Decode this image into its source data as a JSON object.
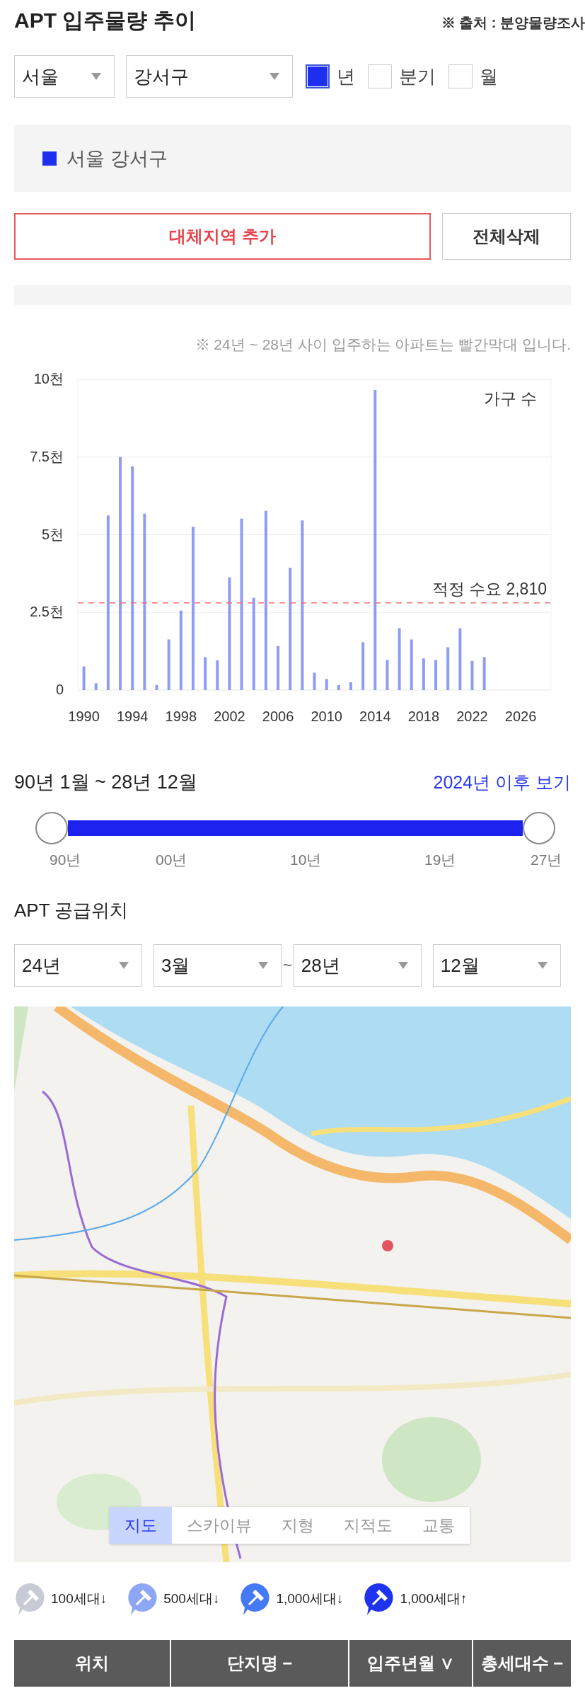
{
  "header": {
    "title": "APT 입주물량 추이",
    "source": "※ 출처 : 분양물량조사"
  },
  "filters": {
    "selects": [
      {
        "value": "서울"
      },
      {
        "value": "강서구"
      }
    ],
    "periods": [
      {
        "label": "년",
        "selected": true
      },
      {
        "label": "분기",
        "selected": false
      },
      {
        "label": "월",
        "selected": false
      }
    ]
  },
  "regions": [
    {
      "label": "서울 강서구",
      "color": "#1e2ff0"
    }
  ],
  "buttons": {
    "add": "대체지역 추가",
    "clear": "전체삭제"
  },
  "note": "※ 24년 ~ 28년 사이 입주하는 아파트는 빨간막대 입니다.",
  "chart": {
    "chart_data": {
      "type": "bar",
      "x": [
        1990,
        1991,
        1992,
        1993,
        1994,
        1995,
        1996,
        1997,
        1998,
        1999,
        2000,
        2001,
        2002,
        2003,
        2004,
        2005,
        2006,
        2007,
        2008,
        2009,
        2010,
        2011,
        2012,
        2013,
        2014,
        2015,
        2016,
        2017,
        2018,
        2019,
        2020,
        2021,
        2022,
        2023
      ],
      "ylabel": "가구 수",
      "series": [
        {
          "color": "#8f9cf5",
          "values": [
            0.76,
            0.22,
            5.62,
            7.5,
            7.2,
            5.68,
            0.16,
            1.63,
            2.56,
            5.26,
            1.06,
            0.96,
            3.63,
            5.52,
            2.97,
            5.77,
            1.42,
            3.94,
            5.46,
            0.56,
            0.36,
            0.16,
            0.25,
            1.54,
            9.66,
            0.97,
            1.99,
            1.63,
            1.02,
            0.97,
            1.38,
            1.99,
            0.94,
            1.06
          ]
        }
      ],
      "xlim": [
        1989.5,
        2028.5
      ],
      "ylim": [
        0,
        10
      ],
      "yticks": [
        {
          "value": 0,
          "label": "0"
        },
        {
          "value": 2.5,
          "label": "2.5천"
        },
        {
          "value": 5,
          "label": "5천"
        },
        {
          "value": 7.5,
          "label": "7.5천"
        },
        {
          "value": 10,
          "label": "10천"
        }
      ],
      "xticks": [
        1990,
        1994,
        1998,
        2002,
        2006,
        2010,
        2014,
        2018,
        2022,
        2026
      ],
      "grid": true,
      "ref_lines": [
        {
          "axis": "y",
          "value": 2.81,
          "label": "적정 수요 2,810",
          "color": "#f07070"
        }
      ]
    }
  },
  "range": {
    "label": "90년 1월 ~ 28년 12월",
    "link": "2024년 이후 보기",
    "selection": {
      "level": 1
    },
    "ticks": [
      "90년",
      "00년",
      "10년",
      "19년",
      "27년"
    ]
  },
  "supply": {
    "title": "APT 공급위치",
    "selects": [
      {
        "value": "24년"
      },
      {
        "value": "3월"
      },
      {
        "value": "28년"
      },
      {
        "value": "12월"
      }
    ],
    "separator": "~",
    "map_tabs": [
      {
        "label": "지도",
        "selected": true
      },
      {
        "label": "스카이뷰",
        "selected": false
      },
      {
        "label": "지형",
        "selected": false
      },
      {
        "label": "지적도",
        "selected": false
      },
      {
        "label": "교통",
        "selected": false
      }
    ],
    "legend": [
      {
        "label": "100세대↓",
        "color": "#c6cbd6"
      },
      {
        "label": "500세대↓",
        "color": "#8ea6f6"
      },
      {
        "label": "1,000세대↓",
        "color": "#457af6"
      },
      {
        "label": "1,000세대↑",
        "color": "#1d33ee"
      }
    ]
  },
  "table": {
    "columns": [
      "위치",
      "단지명 −",
      "입주년월 ∨",
      "총세대수 −"
    ]
  }
}
